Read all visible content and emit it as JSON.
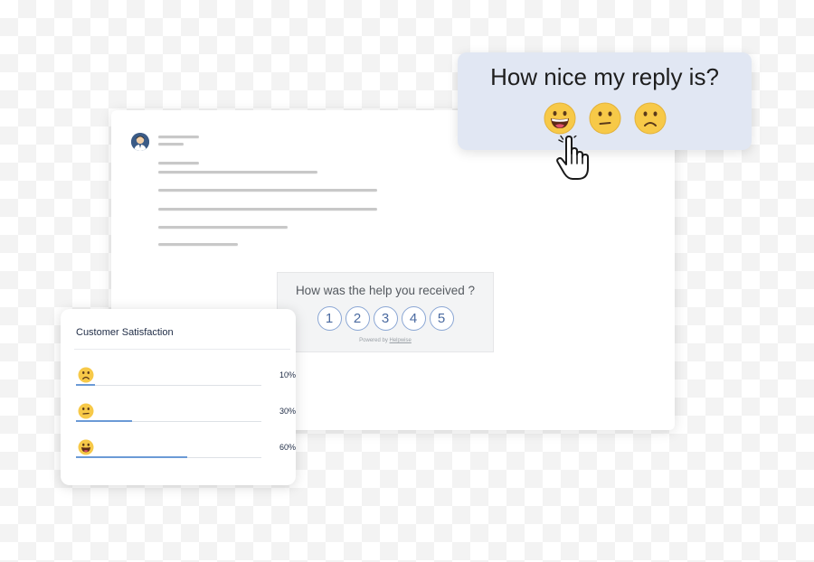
{
  "reply_prompt": {
    "question": "How nice my reply is?",
    "faces": [
      "grinning-face-icon",
      "neutral-face-icon",
      "frowning-face-icon"
    ]
  },
  "rating_widget": {
    "question": "How was the help you received ?",
    "options": [
      "1",
      "2",
      "3",
      "4",
      "5"
    ],
    "powered_by": "Powered by",
    "powered_brand": "Helpwise"
  },
  "csat": {
    "title": "Customer Satisfaction",
    "rows": [
      {
        "face": "frowning-face-icon",
        "percent": "10%",
        "value": 0.1
      },
      {
        "face": "neutral-face-icon",
        "percent": "30%",
        "value": 0.3
      },
      {
        "face": "grinning-face-icon",
        "percent": "60%",
        "value": 0.6
      }
    ]
  },
  "colors": {
    "accent": "#6b9ad6",
    "tooltip_bg": "#e1e7f3",
    "face_yellow": "#f7c948"
  }
}
